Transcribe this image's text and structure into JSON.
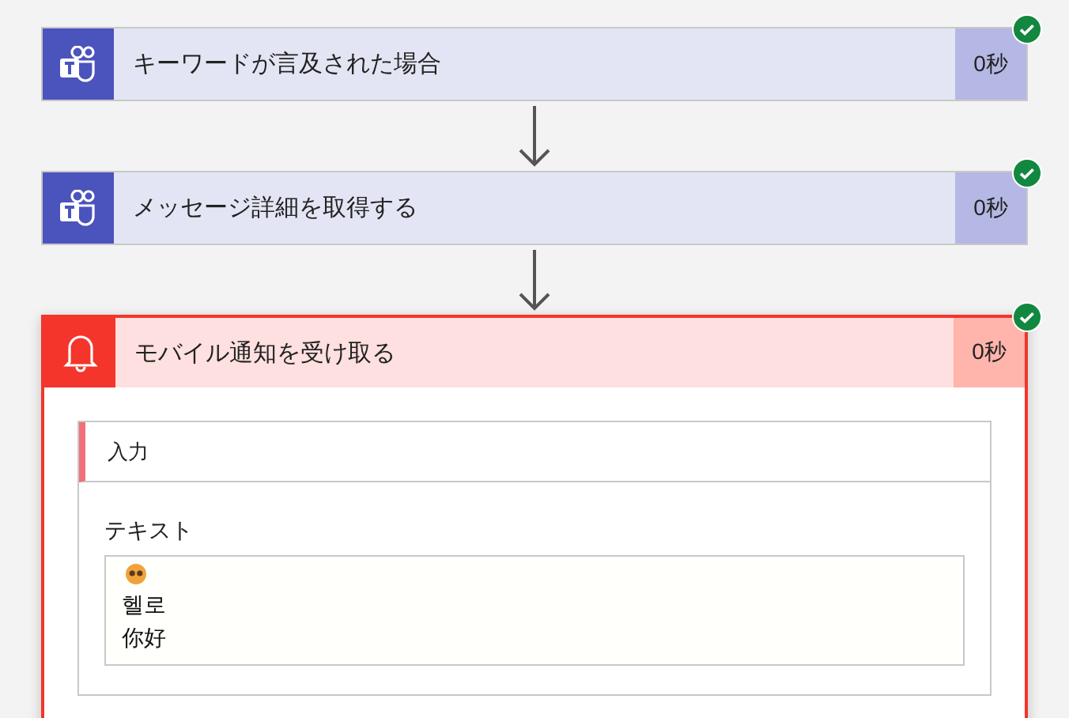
{
  "steps": [
    {
      "kind": "teams",
      "title": "キーワードが言及された場合",
      "duration": "0秒",
      "succeeded": true,
      "expanded": false
    },
    {
      "kind": "teams",
      "title": "メッセージ詳細を取得する",
      "duration": "0秒",
      "succeeded": true,
      "expanded": false
    },
    {
      "kind": "notification",
      "title": "モバイル通知を受け取る",
      "duration": "0秒",
      "succeeded": true,
      "expanded": true,
      "inputs": {
        "title": "入力",
        "fields": [
          {
            "label": "テキスト",
            "lines": [
              {
                "kind": "emoji"
              },
              {
                "kind": "text",
                "text": "헬로"
              },
              {
                "kind": "text",
                "text": "你好"
              }
            ]
          }
        ]
      }
    }
  ]
}
